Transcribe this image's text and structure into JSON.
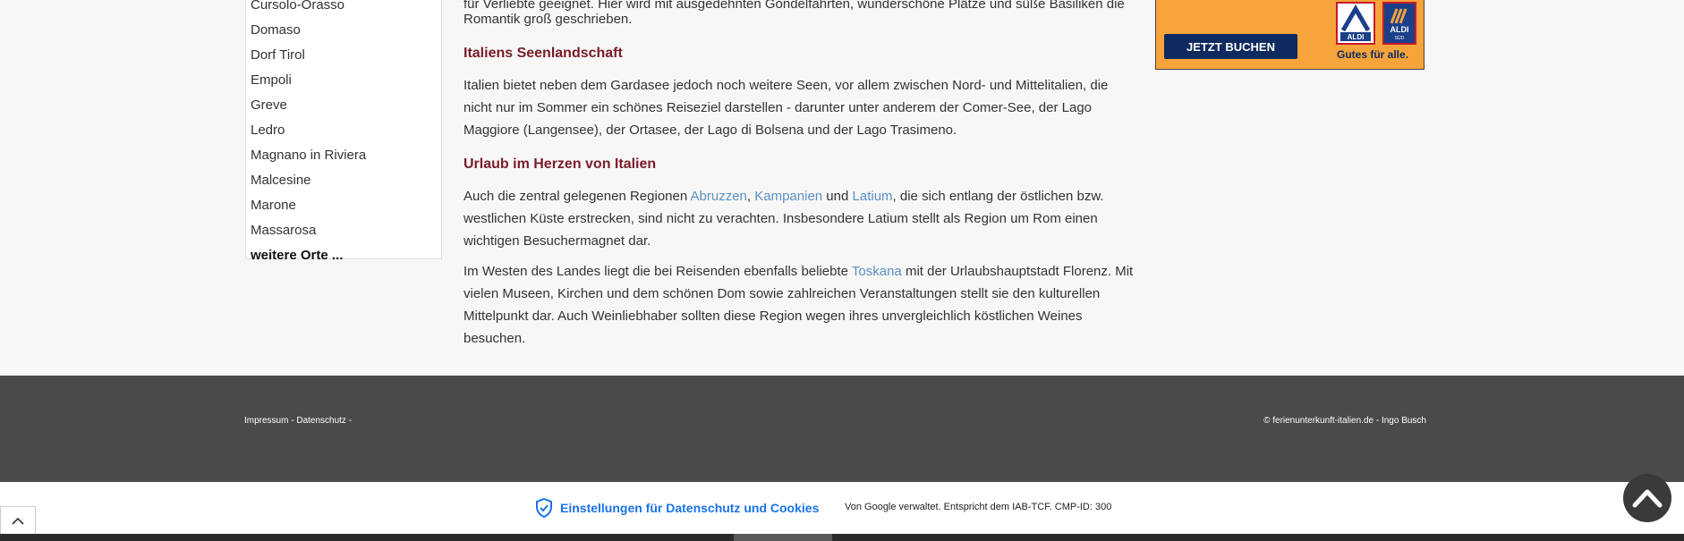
{
  "sidebar": {
    "items": [
      {
        "label": "Cursolo-Orasso"
      },
      {
        "label": "Domaso"
      },
      {
        "label": "Dorf Tirol"
      },
      {
        "label": "Empoli"
      },
      {
        "label": "Greve"
      },
      {
        "label": "Ledro"
      },
      {
        "label": "Magnano in Riviera"
      },
      {
        "label": "Malcesine"
      },
      {
        "label": "Marone"
      },
      {
        "label": "Massarosa"
      }
    ],
    "more_label": "weitere Orte ..."
  },
  "content": {
    "intro_line1": "für Verliebte geeignet. Hier wird mit ausgedehnten Gondelfahrten, wunderschöne Plätze und süße Basiliken die",
    "intro_line2": "Romantik groß geschrieben.",
    "section1": {
      "heading": "Italiens Seenlandschaft",
      "text": "Italien bietet neben dem Gardasee jedoch noch weitere Seen, vor allem zwischen Nord- und Mittelitalien, die nicht nur im Sommer ein schönes Reiseziel darstellen - darunter unter anderem der Comer-See, der Lago Maggiore (Langensee), der Ortasee, der Lago di Bolsena und der Lago Trasimeno."
    },
    "section2": {
      "heading": "Urlaub im Herzen von Italien",
      "p1_before": "Auch die zentral gelegenen Regionen ",
      "link_abruzzen": "Abruzzen",
      "sep1": ", ",
      "link_kampanien": "Kampanien",
      "and": " und ",
      "link_latium": "Latium",
      "p1_after": ", die sich entlang der östlichen bzw. westlichen Küste erstrecken, sind nicht zu verachten. Insbesondere Latium stellt als Region um Rom einen wichtigen Besuchermagnet dar.",
      "p2_before": "Im Westen des Landes liegt die bei Reisenden ebenfalls beliebte ",
      "link_toskana": "Toskana",
      "p2_after": " mit der Urlaubshauptstadt Florenz. Mit vielen Museen, Kirchen und dem schönen Dom sowie zahlreichen Veranstaltungen stellt sie den kulturellen Mittelpunkt dar. Auch Weinliebhaber sollten diese Region wegen ihres unvergleichlich köstlichen Weines besuchen."
    }
  },
  "ad": {
    "cta": "JETZT BUCHEN",
    "logo1_text": "ALDI",
    "logo2_text": "ALDI",
    "logo2_sub": "SÜD",
    "tagline": "Gutes für alle."
  },
  "footer": {
    "impressum": "Impressum",
    "sep": " - ",
    "datenschutz": "Datenschutz",
    "trailing": " -",
    "copyright": "© ferienunterkunft-italien.de - Ingo Busch"
  },
  "consent": {
    "button_label": "Einstellungen für Datenschutz und Cookies",
    "info": "Von Google verwaltet. Entspricht dem IAB-TCF. CMP-ID: 300"
  },
  "colors": {
    "heading": "#7a1c2a",
    "link": "#5b8fc3",
    "footer_bg": "#4a4a4a",
    "consent_link": "#1a73e8",
    "ad_bg": "#f7a43c"
  },
  "icons": {
    "back_to_top": "chevron-up-icon",
    "consent": "shield-check-icon",
    "corner": "chevron-up-icon"
  }
}
